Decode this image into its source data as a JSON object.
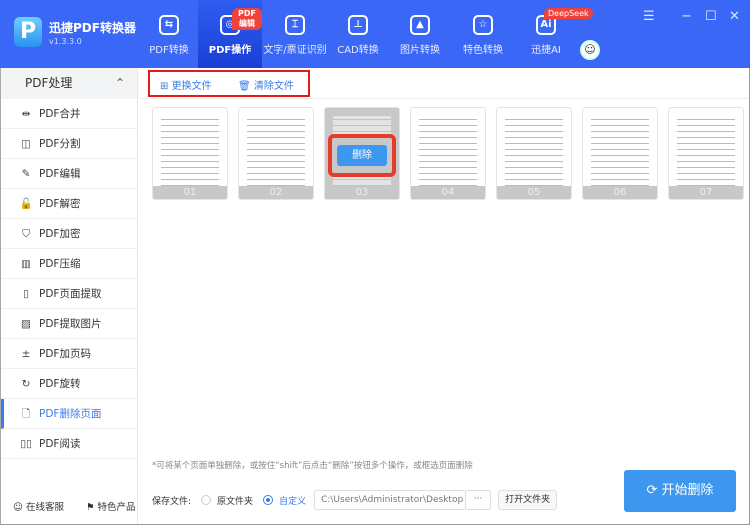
{
  "app": {
    "name": "迅捷PDF转换器",
    "version": "v1.3.3.0",
    "logo_letter": "P"
  },
  "nav": {
    "tabs": [
      {
        "label": "PDF转换",
        "icon": "convert-icon",
        "glyph": "⇆"
      },
      {
        "label": "PDF操作",
        "icon": "gear-icon",
        "glyph": "◎",
        "badge": "PDF编辑",
        "active": true
      },
      {
        "label": "文字/票证识别",
        "icon": "scan-icon",
        "glyph": "⌶"
      },
      {
        "label": "CAD转换",
        "icon": "cad-icon",
        "glyph": "⊥"
      },
      {
        "label": "图片转换",
        "icon": "image-icon",
        "glyph": "▲"
      },
      {
        "label": "特色转换",
        "icon": "star-icon",
        "glyph": "☆"
      },
      {
        "label": "迅捷AI",
        "icon": "ai-icon",
        "glyph": "Ai",
        "badge": "DeepSeek"
      }
    ]
  },
  "window": {
    "menu": "☰",
    "minimize": "−",
    "maximize": "☐",
    "close": "✕",
    "avatar": "☺"
  },
  "sidebar": {
    "header": "PDF处理",
    "chevron": "⌃",
    "items": [
      {
        "label": "PDF合并",
        "glyph": "⇹"
      },
      {
        "label": "PDF分割",
        "glyph": "◫"
      },
      {
        "label": "PDF编辑",
        "glyph": "✎"
      },
      {
        "label": "PDF解密",
        "glyph": "🔓"
      },
      {
        "label": "PDF加密",
        "glyph": "⛉"
      },
      {
        "label": "PDF压缩",
        "glyph": "▥"
      },
      {
        "label": "PDF页面提取",
        "glyph": "▯"
      },
      {
        "label": "PDF提取图片",
        "glyph": "▨"
      },
      {
        "label": "PDF加页码",
        "glyph": "±"
      },
      {
        "label": "PDF旋转",
        "glyph": "↻"
      },
      {
        "label": "PDF删除页面",
        "glyph": "🗋",
        "active": true
      },
      {
        "label": "PDF阅读",
        "glyph": "▯▯"
      }
    ],
    "footer": [
      {
        "label": "在线客服",
        "glyph": "☺"
      },
      {
        "label": "特色产品",
        "glyph": "⚑"
      }
    ]
  },
  "toolbar": {
    "replace": "更换文件",
    "clear": "清除文件"
  },
  "pages": [
    "01",
    "02",
    "03",
    "04",
    "05",
    "06",
    "07"
  ],
  "selected_page": "03",
  "delete_label": "删除",
  "hint": "*可将某个页面单独删除，或按住“shift”后点击“删除”按钮多个操作，或框选页面删除",
  "save": {
    "label": "保存文件:",
    "option_original": "原文件夹",
    "option_custom": "自定义",
    "selected": "自定义",
    "path": "C:\\Users\\Administrator\\Desktop",
    "browse": "···",
    "open_folder": "打开文件夹"
  },
  "start_button": "开始删除",
  "colors": {
    "header": "#3b67f6",
    "accent": "#3d97ee",
    "highlight": "#e21a1a"
  }
}
